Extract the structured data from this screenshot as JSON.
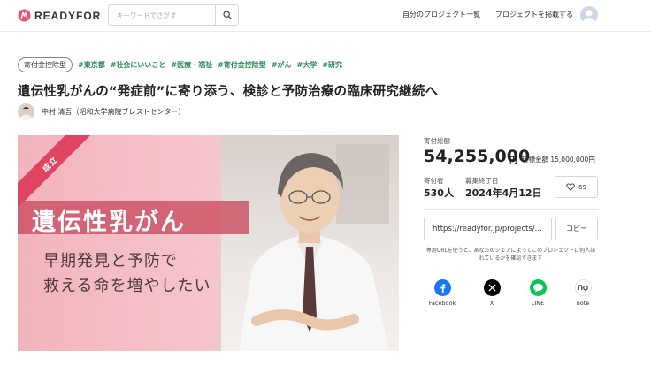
{
  "header": {
    "logo_text": "READYFOR",
    "search_placeholder": "キーワードでさがす",
    "nav": [
      "自分のプロジェクト一覧",
      "プロジェクトを掲載する"
    ]
  },
  "project": {
    "type_badge": "寄付金控除型",
    "tags": [
      "#東京都",
      "#社会にいいこと",
      "#医療・福祉",
      "#寄付金控除型",
      "#がん",
      "#大学",
      "#研究"
    ],
    "title": "遺伝性乳がんの“発症前”に寄り添う、検診と予防治療の臨床研究継続へ",
    "owner": "中村 清吾（昭和大学病院ブレストセンター）"
  },
  "hero": {
    "status_ribbon": "成立",
    "headline": "遺伝性乳がん",
    "line1": "早期発見と予防で",
    "line2": "救える命を増やしたい"
  },
  "stats": {
    "total_label": "寄付総額",
    "total_value": "54,255,000",
    "total_unit": "円",
    "goal_text": "目標金額 15,000,000円",
    "supporters_label": "寄付者",
    "supporters_value": "530人",
    "end_label": "募集終了日",
    "end_value": "2024年4月12日",
    "likes": "69"
  },
  "share": {
    "url": "https://readyfor.jp/projects/...",
    "copy_label": "コピー",
    "note": "専用URLを使うと、あなたのシェアによってこのプロジェクトに何人訪れているかを確認できます",
    "buttons": [
      {
        "label": "Facebook",
        "color": "#1877f2"
      },
      {
        "label": "X",
        "color": "#000000"
      },
      {
        "label": "LINE",
        "color": "#06c755"
      },
      {
        "label": "note",
        "color": "#ffffff"
      }
    ]
  },
  "colors": {
    "accent": "#e04463",
    "tag_green": "#2a8a5a"
  }
}
